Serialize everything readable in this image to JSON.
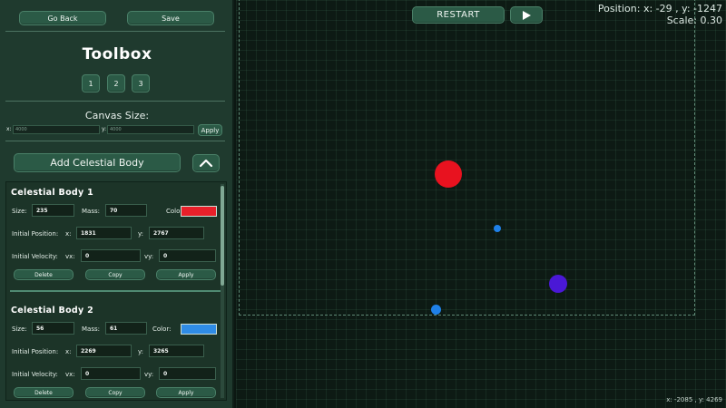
{
  "sidebar": {
    "go_back": "Go Back",
    "save": "Save",
    "title": "Toolbox",
    "tabs": [
      "1",
      "2",
      "3"
    ],
    "canvas_size": {
      "label": "Canvas Size:",
      "x_label": "x:",
      "x_placeholder": "4000",
      "y_label": "y:",
      "y_placeholder": "4000",
      "apply": "Apply"
    },
    "add_body": "Add Celestial Body",
    "collapse_icon": "chevron-up-icon"
  },
  "bodies": [
    {
      "title": "Celestial Body 1",
      "size_label": "Size:",
      "size": "235",
      "mass_label": "Mass:",
      "mass": "70",
      "color_label": "Color:",
      "color": "#e8202a",
      "pos_label": "Initial Position:",
      "x_label": "x:",
      "x": "1831",
      "y_label": "y:",
      "y": "2767",
      "vel_label": "Initial Velocity:",
      "vx_label": "vx:",
      "vx": "0",
      "vy_label": "vy:",
      "vy": "0",
      "delete": "Delete",
      "copy": "Copy",
      "apply": "Apply"
    },
    {
      "title": "Celestial Body 2",
      "size_label": "Size:",
      "size": "56",
      "mass_label": "Mass:",
      "mass": "61",
      "color_label": "Color:",
      "color": "#2f8ce6",
      "pos_label": "Initial Position:",
      "x_label": "x:",
      "x": "2269",
      "y_label": "y:",
      "y": "3265",
      "vel_label": "Initial Velocity:",
      "vx_label": "vx:",
      "vx": "0",
      "vy_label": "vy:",
      "vy": "0",
      "delete": "Delete",
      "copy": "Copy",
      "apply": "Apply"
    }
  ],
  "canvas": {
    "restart": "RESTART",
    "play_icon": "play-icon",
    "position_text": "Position: x: -29 , y: -1247",
    "scale_text": "Scale: 0.30",
    "cursor_coords": "x: -2085 , y: 4269",
    "grid": true,
    "dot_colors": {
      "red": "#e8121f",
      "blue": "#1f80e8",
      "purple": "#4a18d6"
    }
  }
}
